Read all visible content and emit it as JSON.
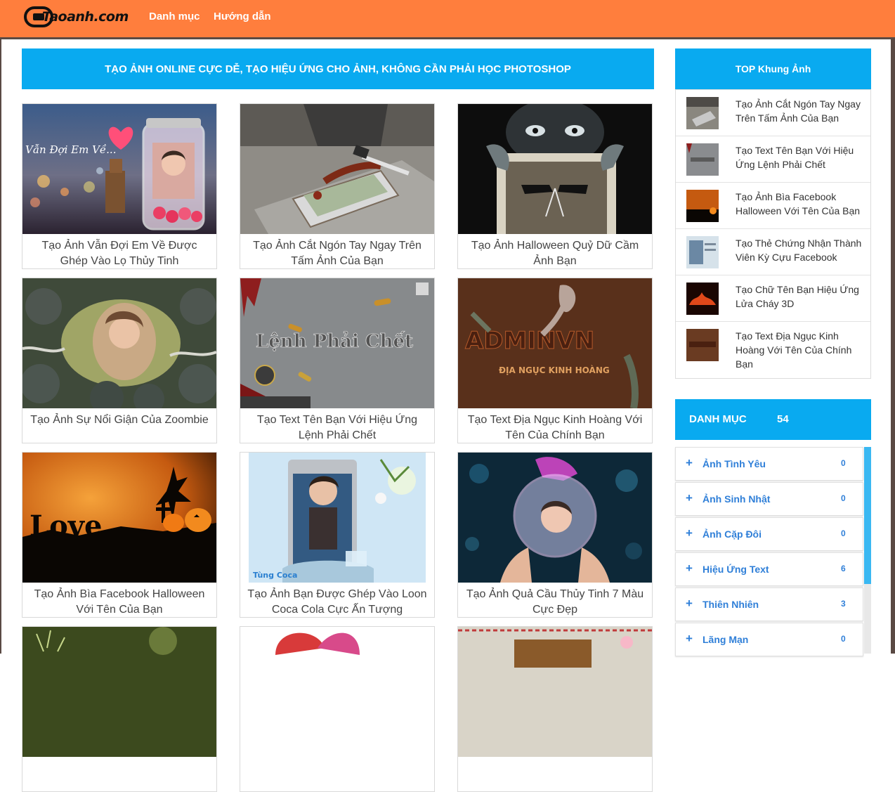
{
  "header": {
    "logo_text": "Taoanh.com",
    "nav": [
      "Danh mục",
      "Hướng dẫn"
    ]
  },
  "banner": "TẠO ẢNH ONLINE CỰC DỄ, TẠO HIỆU ỨNG CHO ẢNH, KHÔNG CẦN PHẢI HỌC PHOTOSHOP",
  "cards": [
    {
      "title": "Tạo Ảnh Vẫn Đợi Em Về Được Ghép Vào Lọ Thủy Tinh",
      "overlay": "Vẫn Đợi Em Về..."
    },
    {
      "title": "Tạo Ảnh Cắt Ngón Tay Ngay Trên Tấm Ảnh Của Bạn"
    },
    {
      "title": "Tạo Ảnh Halloween Quỷ Dữ Cầm Ảnh Bạn"
    },
    {
      "title": "Tạo Ảnh Sự Nổi Giận Của Zoombie"
    },
    {
      "title": "Tạo Text Tên Bạn Với Hiệu Ứng Lệnh Phải Chết",
      "overlay": "Lệnh Phải Chết"
    },
    {
      "title": "Tạo Text Địa Ngục Kinh Hoàng Với Tên Của Chính Bạn",
      "overlay": "ĐỊA NGỤC KINH HOÀNG"
    },
    {
      "title": "Tạo Ảnh Bìa Facebook Halloween Với Tên Của Bạn",
      "overlay": "Love"
    },
    {
      "title": "Tạo Ảnh Bạn Được Ghép Vào Loon Coca Cola Cực Ấn Tượng",
      "overlay": "Tùng Coca"
    },
    {
      "title": "Tạo Ảnh Quả Cầu Thủy Tinh 7 Màu Cực Đẹp"
    }
  ],
  "sidebar": {
    "top_title": "TOP Khung Ảnh",
    "top_items": [
      "Tạo Ảnh Cắt Ngón Tay Ngay Trên Tấm Ảnh Của Bạn",
      "Tạo Text Tên Bạn Với Hiệu Ứng Lệnh Phải Chết",
      "Tạo Ảnh Bìa Facebook Halloween Với Tên Của Bạn",
      "Tạo Thẻ Chứng Nhận Thành Viên Kỳ Cựu Facebook",
      "Tạo Chữ Tên Bạn Hiệu Ứng Lửa Cháy 3D",
      "Tạo Text Địa Ngục Kinh Hoàng Với Tên Của Chính Bạn"
    ],
    "category_title": "DANH MỤC",
    "category_count": "54",
    "categories": [
      {
        "name": "Ảnh Tình Yêu",
        "count": "0"
      },
      {
        "name": "Ảnh Sinh Nhật",
        "count": "0"
      },
      {
        "name": "Ảnh Cặp Đôi",
        "count": "0"
      },
      {
        "name": "Hiệu Ứng Text",
        "count": "6"
      },
      {
        "name": "Thiên Nhiên",
        "count": "3"
      },
      {
        "name": "Lãng Mạn",
        "count": "0"
      }
    ]
  },
  "colors": {
    "header": "#ff7e3d",
    "accent": "#09aaf0",
    "link": "#2f7fd8"
  }
}
